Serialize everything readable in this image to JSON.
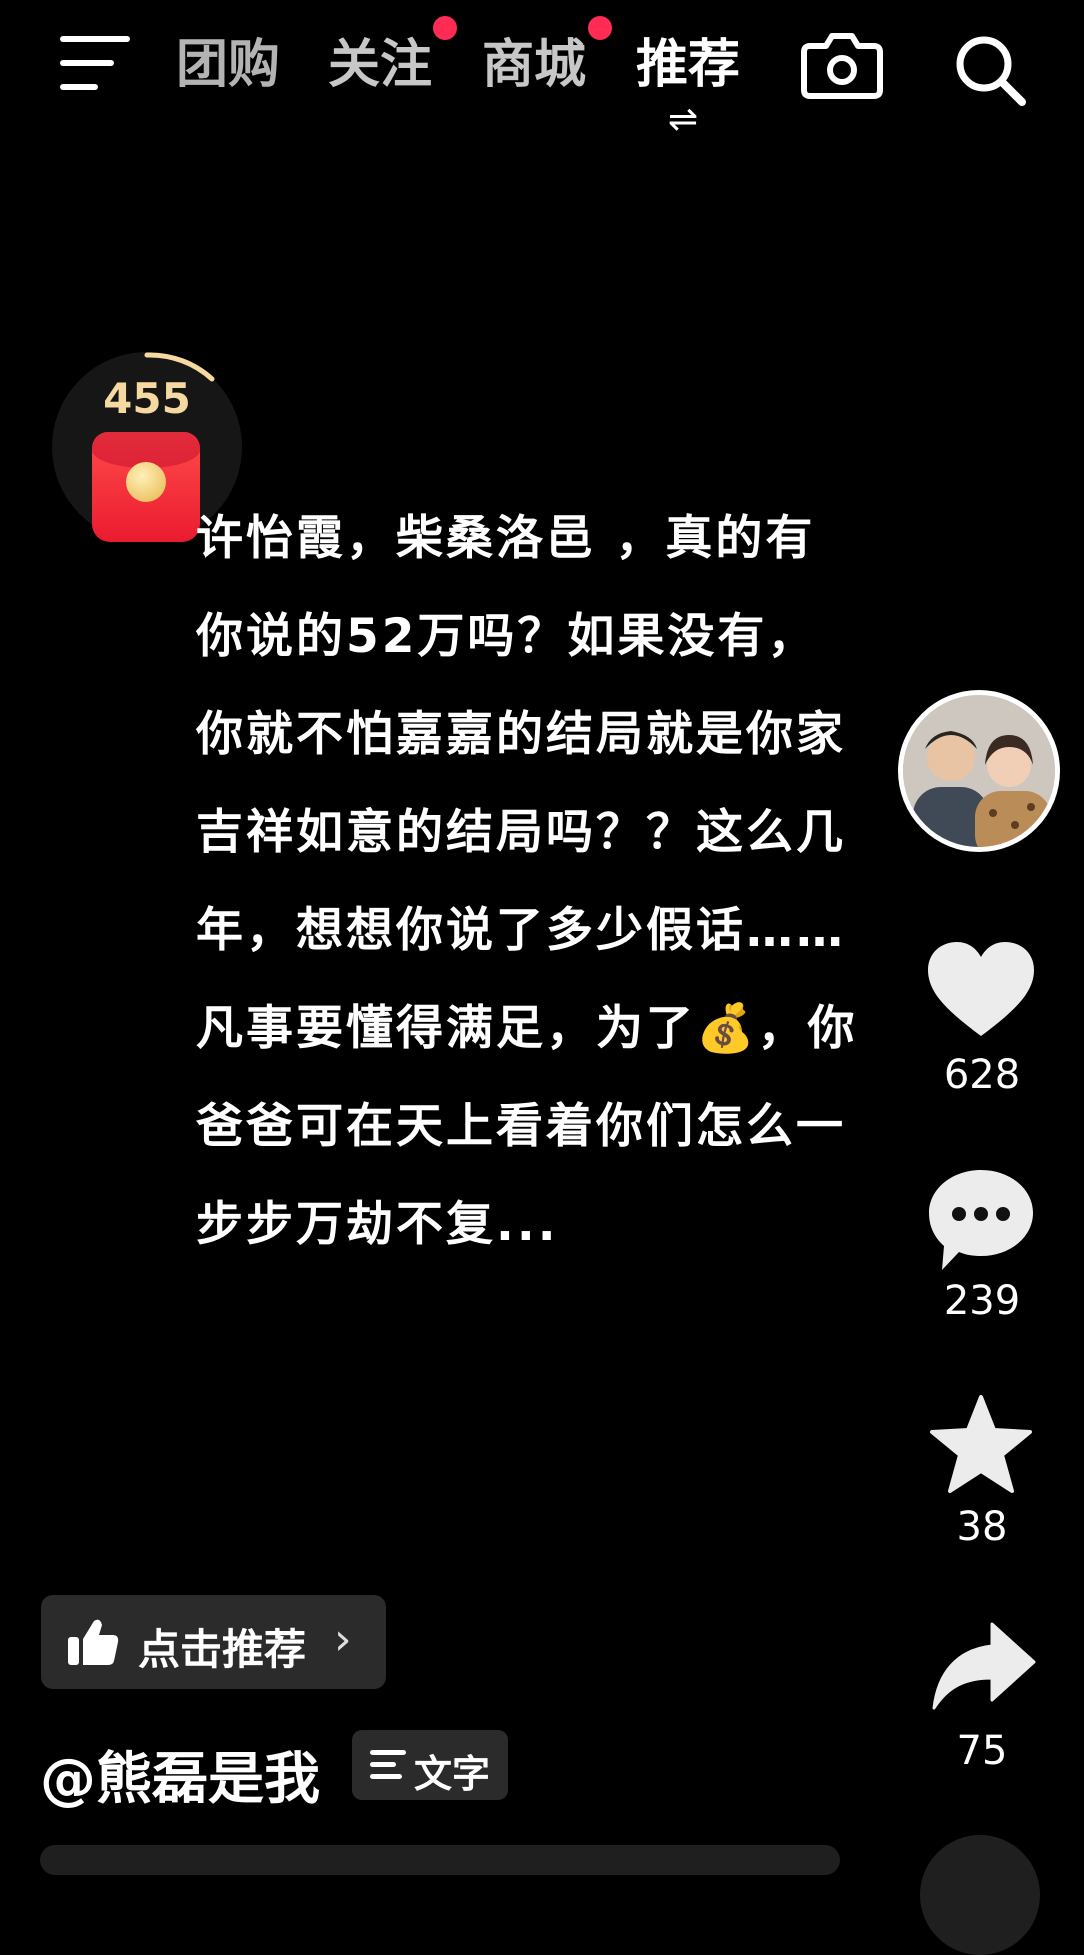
{
  "nav": {
    "tabs": [
      {
        "label": "团购",
        "active": false,
        "has_dot": false
      },
      {
        "label": "关注",
        "active": false,
        "has_dot": true
      },
      {
        "label": "商城",
        "active": false,
        "has_dot": true
      },
      {
        "label": "推荐",
        "active": true,
        "has_dot": false
      }
    ],
    "switch_glyph": "⇌",
    "icons": [
      "menu-icon",
      "camera-icon",
      "search-icon"
    ]
  },
  "red_packet": {
    "count": "455"
  },
  "post": {
    "lines": [
      "许怡霞，柴桑洛邑 ，真的有",
      "你说的52万吗？如果没有，",
      "你就不怕嘉嘉的结局就是你家",
      "吉祥如意的结局吗？？这么几",
      "年，想想你说了多少假话……",
      "凡事要懂得满足，为了💰，你",
      "爸爸可在天上看着你们怎么一",
      "步步万劫不复..."
    ]
  },
  "actions": {
    "likes": "628",
    "comments": "239",
    "favorites": "38",
    "shares": "75"
  },
  "recommend_button": {
    "label": "点击推荐"
  },
  "author": {
    "handle": "@熊磊是我"
  },
  "text_tag": {
    "label": "文字"
  },
  "colors": {
    "accent_dot": "#fe2c55",
    "packet_red": "#ea1b2f",
    "count_gold": "#f6d9a0"
  }
}
